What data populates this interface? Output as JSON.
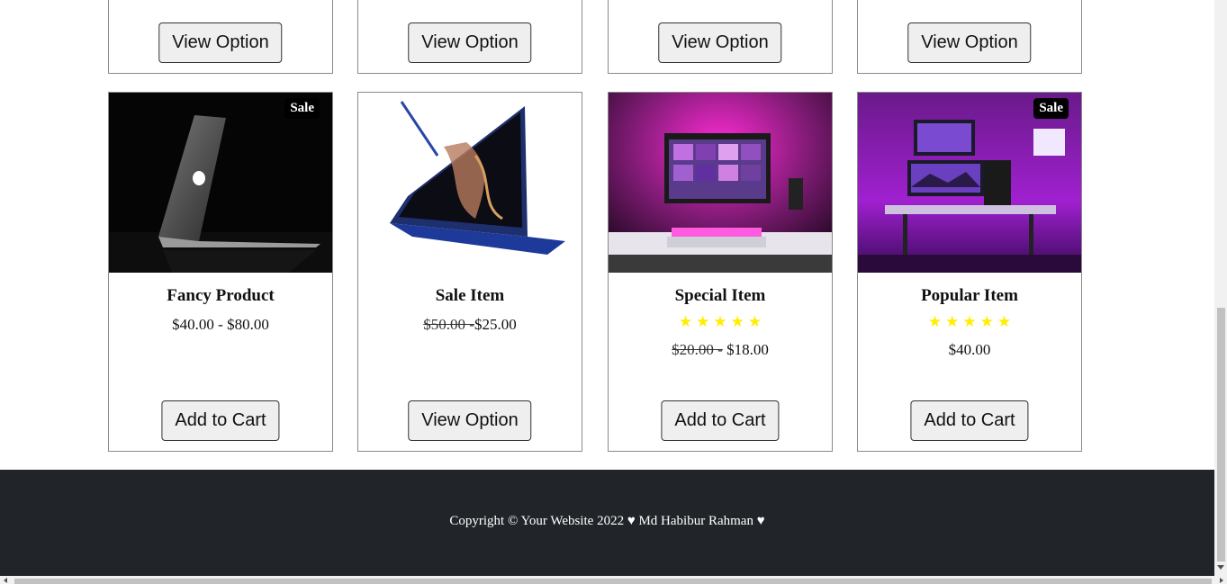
{
  "top_row": [
    {
      "button": "View Option"
    },
    {
      "button": "View Option"
    },
    {
      "button": "View Option"
    },
    {
      "button": "View Option"
    }
  ],
  "products": [
    {
      "image": "laptop-macbook-dark",
      "badge": "Sale",
      "title": "Fancy Product",
      "price_from": "$40.00",
      "price_sep": " - ",
      "price_to": "$80.00",
      "button": "Add to Cart"
    },
    {
      "image": "laptop-blue-tablet-mode",
      "title": "Sale Item",
      "old_price": "$50.00 -",
      "new_price": "$25.00",
      "button": "View Option"
    },
    {
      "image": "desk-setup-pink",
      "title": "Special Item",
      "rating": 5,
      "stars": [
        "★",
        "★",
        "★",
        "★",
        "★"
      ],
      "old_price": "$20.00 -",
      "new_price": " $18.00",
      "button": "Add to Cart"
    },
    {
      "image": "desk-setup-purple",
      "badge": "Sale",
      "title": "Popular Item",
      "rating": 5,
      "stars": [
        "★",
        "★",
        "★",
        "★",
        "★"
      ],
      "price": "$40.00",
      "button": "Add to Cart"
    }
  ],
  "footer": {
    "copyright": "Copyright © Your Website 2022 ♥ Md Habibur Rahman ♥"
  },
  "colors": {
    "footer_bg": "#212529",
    "star": "#ffee00",
    "button_bg": "#efefef"
  }
}
